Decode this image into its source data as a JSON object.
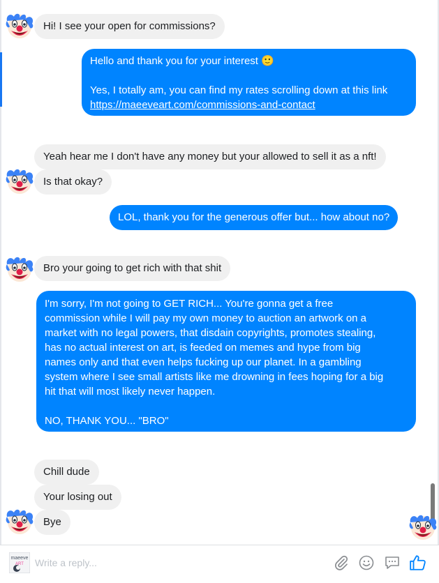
{
  "conversation": {
    "messages": [
      {
        "from": "them",
        "text": "Hi! I see your open for commissions?"
      },
      {
        "from": "me",
        "lines": [
          "Hello and thank you for your interest 🙂",
          "",
          "Yes, I totally am, you can find my rates scrolling down at this link"
        ],
        "link": "https://maeeveart.com/commissions-and-contact"
      },
      {
        "from": "them",
        "text": "Yeah hear me I don't have any money but your allowed to sell it as a nft!"
      },
      {
        "from": "them",
        "text": "Is that okay?"
      },
      {
        "from": "me",
        "text": "LOL, thank you for the generous offer but... how about no?"
      },
      {
        "from": "them",
        "text": "Bro your going to get rich with that shit"
      },
      {
        "from": "me",
        "lines": [
          "I'm sorry, I'm not going to GET RICH... You're gonna get a free",
          "commission while I will pay my own money to auction an artwork on a",
          "market with no legal powers, that disdain copyrights, promotes stealing,",
          "has no actual interest on art, is feeded on memes and hype from big",
          "names only and that even helps fucking up our planet. In a gambling",
          "system where I see small artists like me drowning in fees hoping for a big",
          "hit that will most likely never happen.",
          "",
          "NO, THANK YOU... \"BRO\""
        ]
      },
      {
        "from": "them",
        "text": "Chill dude"
      },
      {
        "from": "them",
        "text": "Your losing out"
      },
      {
        "from": "them",
        "text": "Bye"
      }
    ]
  },
  "composer": {
    "placeholder": "Write a reply...",
    "my_avatar_text": [
      "maeeve",
      "ART"
    ]
  },
  "icons": {
    "contact_avatar": "clown-face-icon",
    "read_receipt": "clown-face-icon",
    "attach": "paperclip-icon",
    "emoji": "smiley-icon",
    "gif": "speech-bubble-icon",
    "like": "thumbs-up-icon"
  },
  "colors": {
    "outgoing_bubble": "#0084ff",
    "incoming_bubble": "#f0f0f0",
    "accent": "#1877f2",
    "like_icon": "#0084ff"
  }
}
